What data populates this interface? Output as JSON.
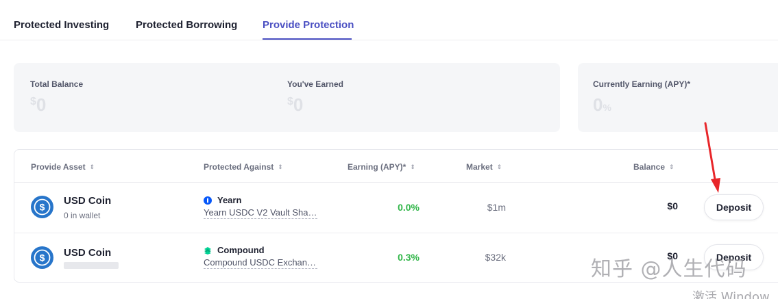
{
  "tabs": [
    {
      "label": "Protected Investing",
      "active": false
    },
    {
      "label": "Protected Borrowing",
      "active": false
    },
    {
      "label": "Provide Protection",
      "active": true
    }
  ],
  "summary": {
    "total_balance": {
      "label": "Total Balance",
      "currency": "$",
      "value": "0"
    },
    "earned": {
      "label": "You've Earned",
      "currency": "$",
      "value": "0"
    },
    "apy": {
      "label": "Currently Earning (APY)*",
      "value": "0",
      "unit": "%"
    }
  },
  "table": {
    "columns": [
      "Provide Asset",
      "Protected Against",
      "Earning (APY)*",
      "Market",
      "Balance"
    ],
    "rows": [
      {
        "asset": "USD Coin",
        "asset_sub": "0 in wallet",
        "protocol": "Yearn",
        "protocol_sub": "Yearn USDC V2 Vault Share…",
        "apy": "0.0%",
        "market": "$1m",
        "balance": "$0",
        "action": "Deposit"
      },
      {
        "asset": "USD Coin",
        "asset_sub": "",
        "protocol": "Compound",
        "protocol_sub": "Compound USDC Exchange…",
        "apy": "0.3%",
        "market": "$32k",
        "balance": "$0",
        "action": "Deposit"
      }
    ]
  },
  "overlay": {
    "watermark": "知乎 @人生代码",
    "windows_activate": "激活 Window"
  },
  "colors": {
    "accent": "#4a4fc2",
    "positive": "#31b649",
    "usdc": "#2775ca",
    "arrow": "#e8262a"
  },
  "icons": {
    "usdc": "usd-coin-icon",
    "yearn": "yearn-icon",
    "compound": "compound-icon",
    "sort": "sort-icon",
    "arrow": "red-arrow-annotation"
  }
}
